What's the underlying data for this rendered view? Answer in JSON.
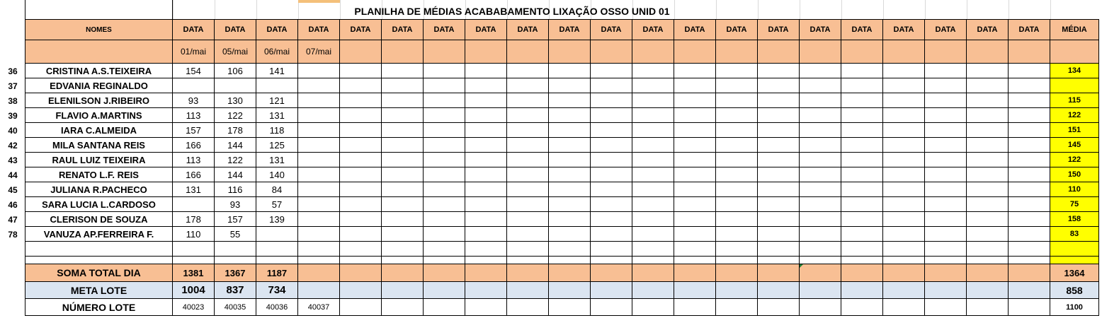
{
  "title": "PLANILHA DE MÉDIAS ACABABAMENTO LIXAÇÃO OSSO UNID 01",
  "headers": {
    "names": "NOMES",
    "data": "DATA",
    "media": "MÉDIA",
    "dates": [
      "01/mai",
      "05/mai",
      "06/mai",
      "07/mai"
    ]
  },
  "rows": [
    {
      "num": "36",
      "name": "CRISTINA A.S.TEIXEIRA",
      "values": [
        "154",
        "106",
        "141"
      ],
      "media": "134"
    },
    {
      "num": "37",
      "name": "EDVANIA REGINALDO",
      "values": [
        "",
        "",
        ""
      ],
      "media": ""
    },
    {
      "num": "38",
      "name": "ELENILSON J.RIBEIRO",
      "values": [
        "93",
        "130",
        "121"
      ],
      "media": "115"
    },
    {
      "num": "39",
      "name": "FLAVIO A.MARTINS",
      "values": [
        "113",
        "122",
        "131"
      ],
      "media": "122"
    },
    {
      "num": "40",
      "name": "IARA C.ALMEIDA",
      "values": [
        "157",
        "178",
        "118"
      ],
      "media": "151"
    },
    {
      "num": "42",
      "name": "MILA SANTANA REIS",
      "values": [
        "166",
        "144",
        "125"
      ],
      "media": "145"
    },
    {
      "num": "43",
      "name": "RAUL LUIZ TEIXEIRA",
      "values": [
        "113",
        "122",
        "131"
      ],
      "media": "122"
    },
    {
      "num": "44",
      "name": "RENATO L.F. REIS",
      "values": [
        "166",
        "144",
        "140"
      ],
      "media": "150"
    },
    {
      "num": "45",
      "name": "JULIANA R.PACHECO",
      "values": [
        "131",
        "116",
        "84"
      ],
      "media": "110"
    },
    {
      "num": "46",
      "name": "SARA LUCIA L.CARDOSO",
      "values": [
        "",
        "93",
        "57"
      ],
      "media": "75"
    },
    {
      "num": "47",
      "name": "CLERISON DE SOUZA",
      "values": [
        "178",
        "157",
        "139"
      ],
      "media": "158"
    },
    {
      "num": "78",
      "name": "VANUZA AP.FERREIRA F.",
      "values": [
        "110",
        "55",
        ""
      ],
      "media": "83"
    }
  ],
  "summary": {
    "soma": {
      "label": "SOMA TOTAL DIA",
      "values": [
        "1381",
        "1367",
        "1187"
      ],
      "media": "1364"
    },
    "meta": {
      "label": "META LOTE",
      "values": [
        "1004",
        "837",
        "734"
      ],
      "media": "858"
    },
    "numero": {
      "label": "NÚMERO LOTE",
      "values": [
        "40023",
        "40035",
        "40036",
        "40037"
      ],
      "media": "1100"
    }
  },
  "colors": {
    "header": "#f8bf94",
    "meta": "#dbe5f1",
    "highlight": "#ffff00"
  }
}
